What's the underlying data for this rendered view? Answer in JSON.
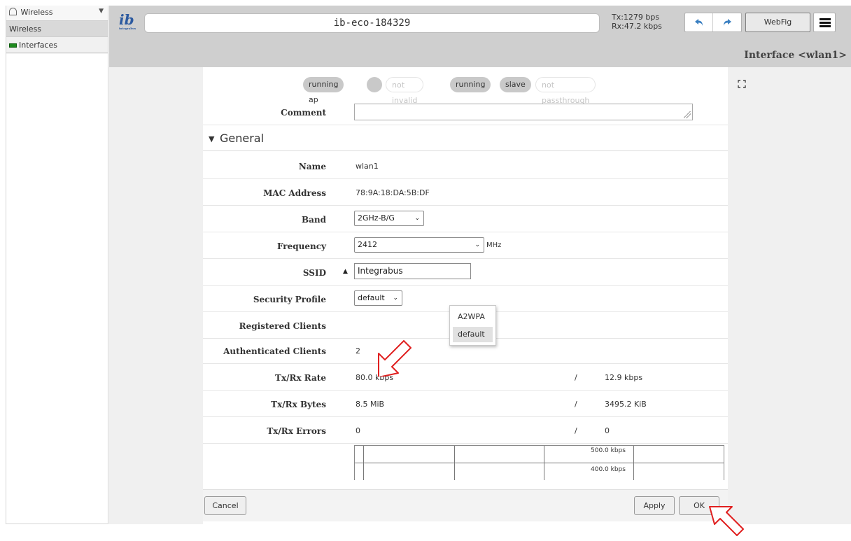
{
  "sidebar": {
    "selector_label": "Wireless",
    "items": [
      {
        "label": "Wireless",
        "active": true
      },
      {
        "label": "Interfaces",
        "icon": "interfaces-icon",
        "active": false
      }
    ]
  },
  "header": {
    "logo_text": "ib",
    "logo_subtext": "integrabus",
    "identity": "ib-eco-184329",
    "tx_rate": "Tx:1279 bps",
    "rx_rate": "Rx:47.2 kbps",
    "webfig_label": "WebFig",
    "page_title": "Interface <wlan1>"
  },
  "flags": [
    {
      "label": "running ap",
      "state": "on"
    },
    {
      "label": "",
      "state": "on"
    },
    {
      "label": "not invalid",
      "state": "off"
    },
    {
      "label": "running",
      "state": "on"
    },
    {
      "label": "slave",
      "state": "on"
    },
    {
      "label": "not passthrough",
      "state": "off"
    }
  ],
  "form": {
    "comment_label": "Comment",
    "comment_value": "",
    "section_title": "General",
    "name_label": "Name",
    "name_value": "wlan1",
    "mac_label": "MAC Address",
    "mac_value": "78:9A:18:DA:5B:DF",
    "band_label": "Band",
    "band_value": "2GHz-B/G",
    "frequency_label": "Frequency",
    "frequency_value": "2412",
    "frequency_unit": "MHz",
    "ssid_label": "SSID",
    "ssid_value": "Integrabus",
    "security_label": "Security Profile",
    "security_value": "default",
    "security_options": [
      "A2WPA",
      "default"
    ],
    "registered_label": "Registered Clients",
    "authenticated_label": "Authenticated Clients",
    "authenticated_value": "2",
    "txrx_rate_label": "Tx/Rx Rate",
    "tx_rate_value": "80.0 kbps",
    "rx_rate_value": "12.9 kbps",
    "txrx_bytes_label": "Tx/Rx Bytes",
    "tx_bytes_value": "8.5 MiB",
    "rx_bytes_value": "3495.2 KiB",
    "txrx_errors_label": "Tx/Rx Errors",
    "tx_errors_value": "0",
    "rx_errors_value": "0",
    "separator": "/",
    "graph_labels": [
      "500.0 kbps",
      "400.0 kbps"
    ]
  },
  "buttons": {
    "cancel": "Cancel",
    "apply": "Apply",
    "ok": "OK"
  },
  "colors": {
    "header_bg": "#cfcfcf",
    "pointer": "#e02020",
    "link_blue": "#3a7fc1"
  }
}
